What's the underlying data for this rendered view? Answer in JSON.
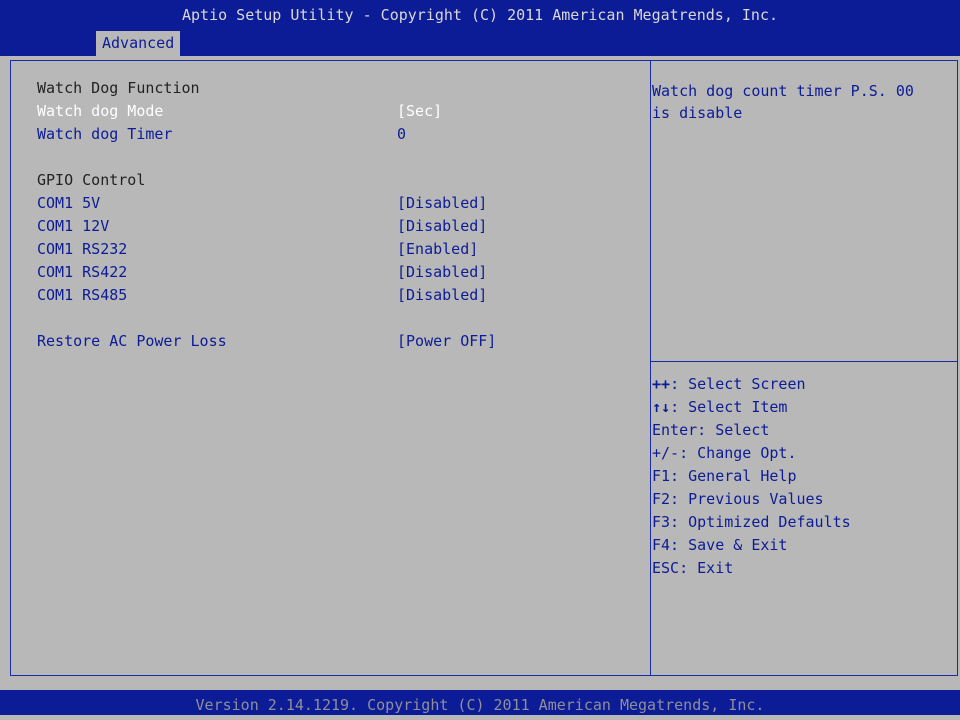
{
  "header": {
    "title": "Aptio Setup Utility - Copyright (C) 2011 American Megatrends, Inc.",
    "tab": "Advanced"
  },
  "settings": {
    "watchdog_section": "Watch Dog Function",
    "watchdog_mode_label": "Watch dog Mode",
    "watchdog_mode_value": "[Sec]",
    "watchdog_timer_label": "Watch dog Timer",
    "watchdog_timer_value": "0",
    "gpio_section": "GPIO Control",
    "com1_5v_label": "COM1 5V",
    "com1_5v_value": "[Disabled]",
    "com1_12v_label": "COM1 12V",
    "com1_12v_value": "[Disabled]",
    "com1_rs232_label": "COM1 RS232",
    "com1_rs232_value": "[Enabled]",
    "com1_rs422_label": "COM1 RS422",
    "com1_rs422_value": "[Disabled]",
    "com1_rs485_label": "COM1 RS485",
    "com1_rs485_value": "[Disabled]",
    "restore_ac_label": "Restore AC Power Loss",
    "restore_ac_value": "[Power OFF]"
  },
  "help": {
    "text": "Watch dog count timer P.S. 00\nis disable"
  },
  "keys": {
    "select_screen_key": "++",
    "select_screen_text": ": Select Screen",
    "select_item_key": "↑↓",
    "select_item_text": ": Select Item",
    "enter": "Enter: Select",
    "change": "+/-: Change Opt.",
    "f1": "F1: General Help",
    "f2": "F2: Previous Values",
    "f3": "F3: Optimized Defaults",
    "f4": "F4: Save & Exit",
    "esc": "ESC: Exit"
  },
  "footer": {
    "version": "Version 2.14.1219. Copyright (C) 2011 American Megatrends, Inc."
  },
  "colors": {
    "background": "#b8b8b8",
    "bar": "#0c1b96",
    "selected_text": "#ffffff"
  }
}
